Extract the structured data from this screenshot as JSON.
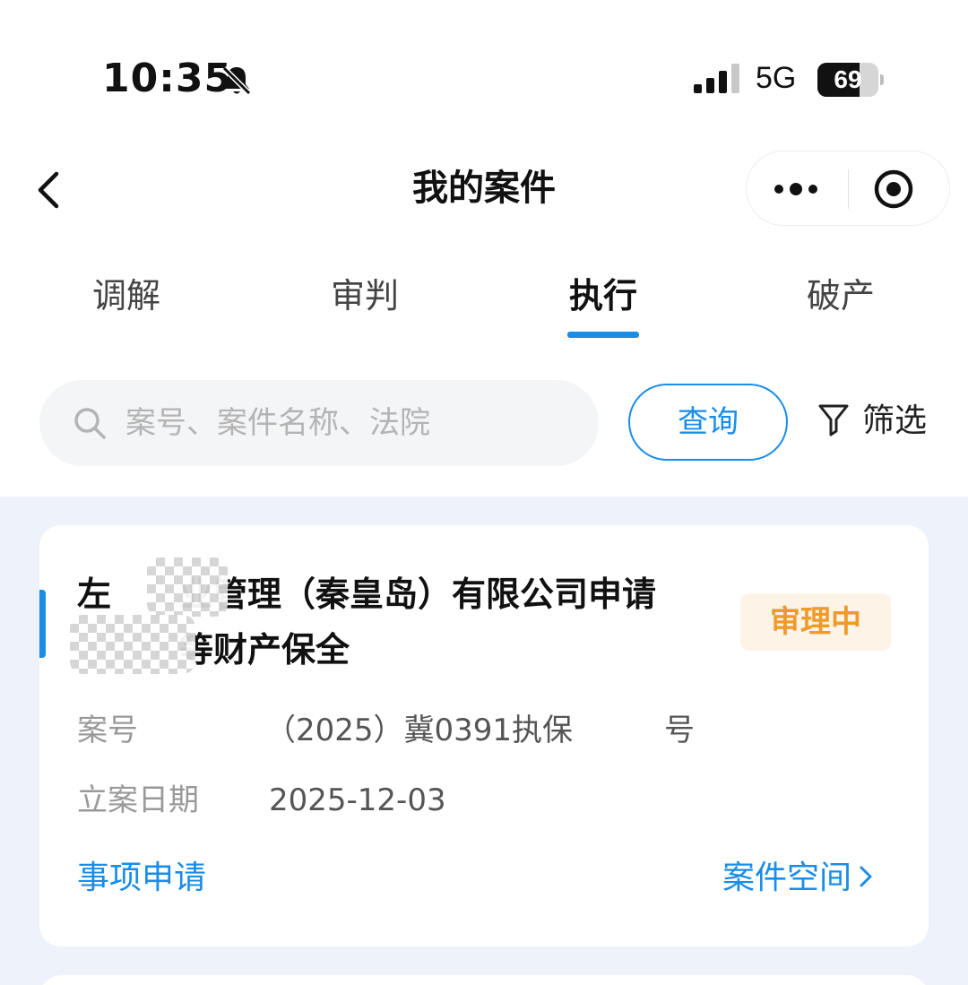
{
  "status_bar": {
    "time": "10:35",
    "network": "5G",
    "battery": "69",
    "battery_level": 0.69,
    "icons": [
      "bell-muted-icon",
      "signal-icon"
    ]
  },
  "nav": {
    "title": "我的案件",
    "icons": [
      "back-arrow-icon",
      "more-dots-icon",
      "target-circle-icon"
    ]
  },
  "tabs": [
    {
      "label": "调解",
      "active": false
    },
    {
      "label": "审判",
      "active": false
    },
    {
      "label": "执行",
      "active": true
    },
    {
      "label": "破产",
      "active": false
    }
  ],
  "search": {
    "placeholder": "案号、案件名称、法院",
    "value": "",
    "query_label": "查询",
    "filter_label": "筛选",
    "icons": [
      "search-icon",
      "filter-funnel-icon"
    ]
  },
  "case": {
    "title_line1": "左　　业管理（秦皇岛）有限公司申请",
    "title_line2": "　　　等财产保全",
    "status": "审理中",
    "case_no_label": "案号",
    "case_no_value": "（2025）冀0391执保　　　号",
    "date_label": "立案日期",
    "date_value": "2025-12-03",
    "action_label": "事项申请",
    "space_label": "案件空间",
    "icons": [
      "chevron-right-icon"
    ]
  },
  "colors": {
    "accent": "#1a8de8",
    "status_orange": "#f09a2a",
    "status_bg": "#fdf3e6",
    "list_bg": "#eef2fb"
  }
}
